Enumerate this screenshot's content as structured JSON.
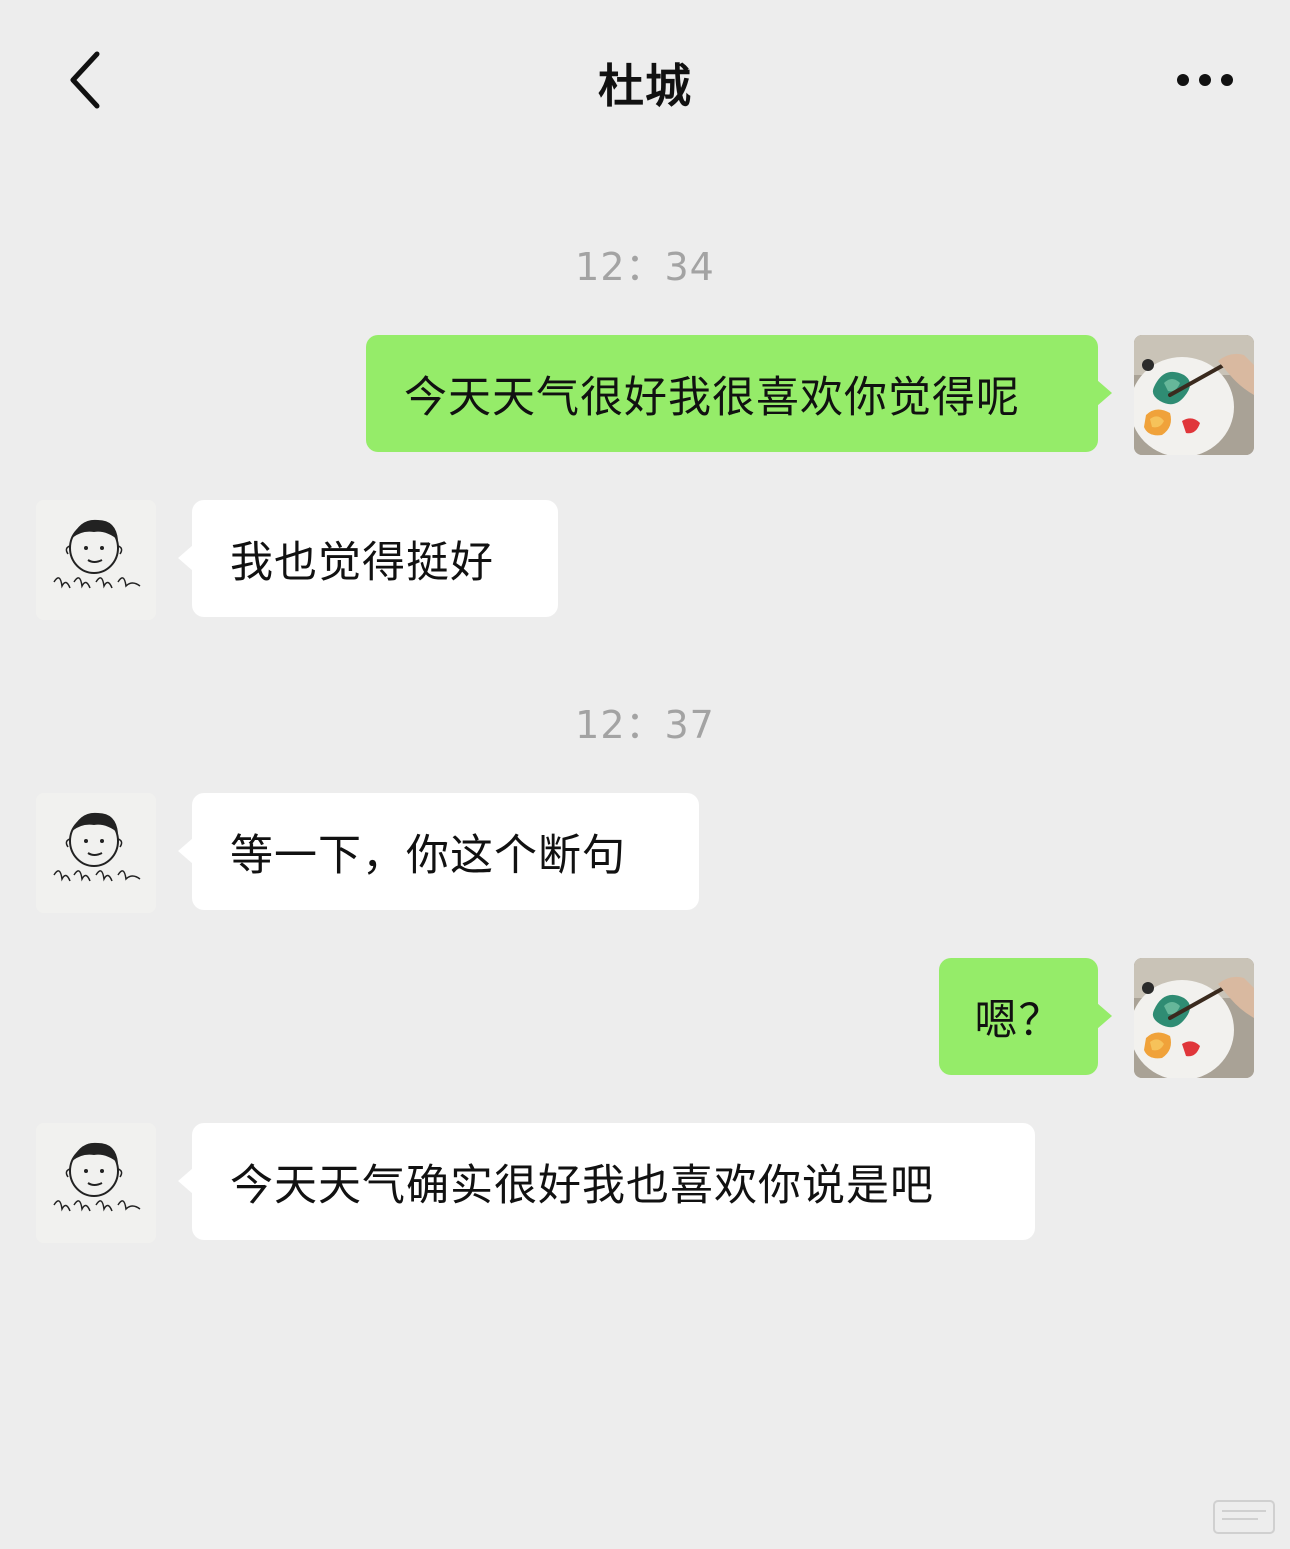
{
  "header": {
    "title": "杜城",
    "back_icon": "chevron-left-icon",
    "more_icon": "ellipsis-icon"
  },
  "timestamps": [
    "12：34",
    "12：37"
  ],
  "messages": [
    {
      "direction": "outgoing",
      "text": "今天天气很好我很喜欢你觉得呢"
    },
    {
      "direction": "incoming",
      "text": "我也觉得挺好"
    },
    {
      "direction": "incoming",
      "text": "等一下，你这个断句"
    },
    {
      "direction": "outgoing",
      "text": "嗯？"
    },
    {
      "direction": "incoming",
      "text": "今天天气确实很好我也喜欢你说是吧"
    }
  ],
  "avatars": {
    "contact": "cartoon-face-sketch-avatar",
    "self": "painting-palette-photo-avatar"
  },
  "colors": {
    "background": "#ededed",
    "outgoing_bubble": "#95ec69",
    "incoming_bubble": "#ffffff",
    "timestamp": "#a3a3a3"
  }
}
